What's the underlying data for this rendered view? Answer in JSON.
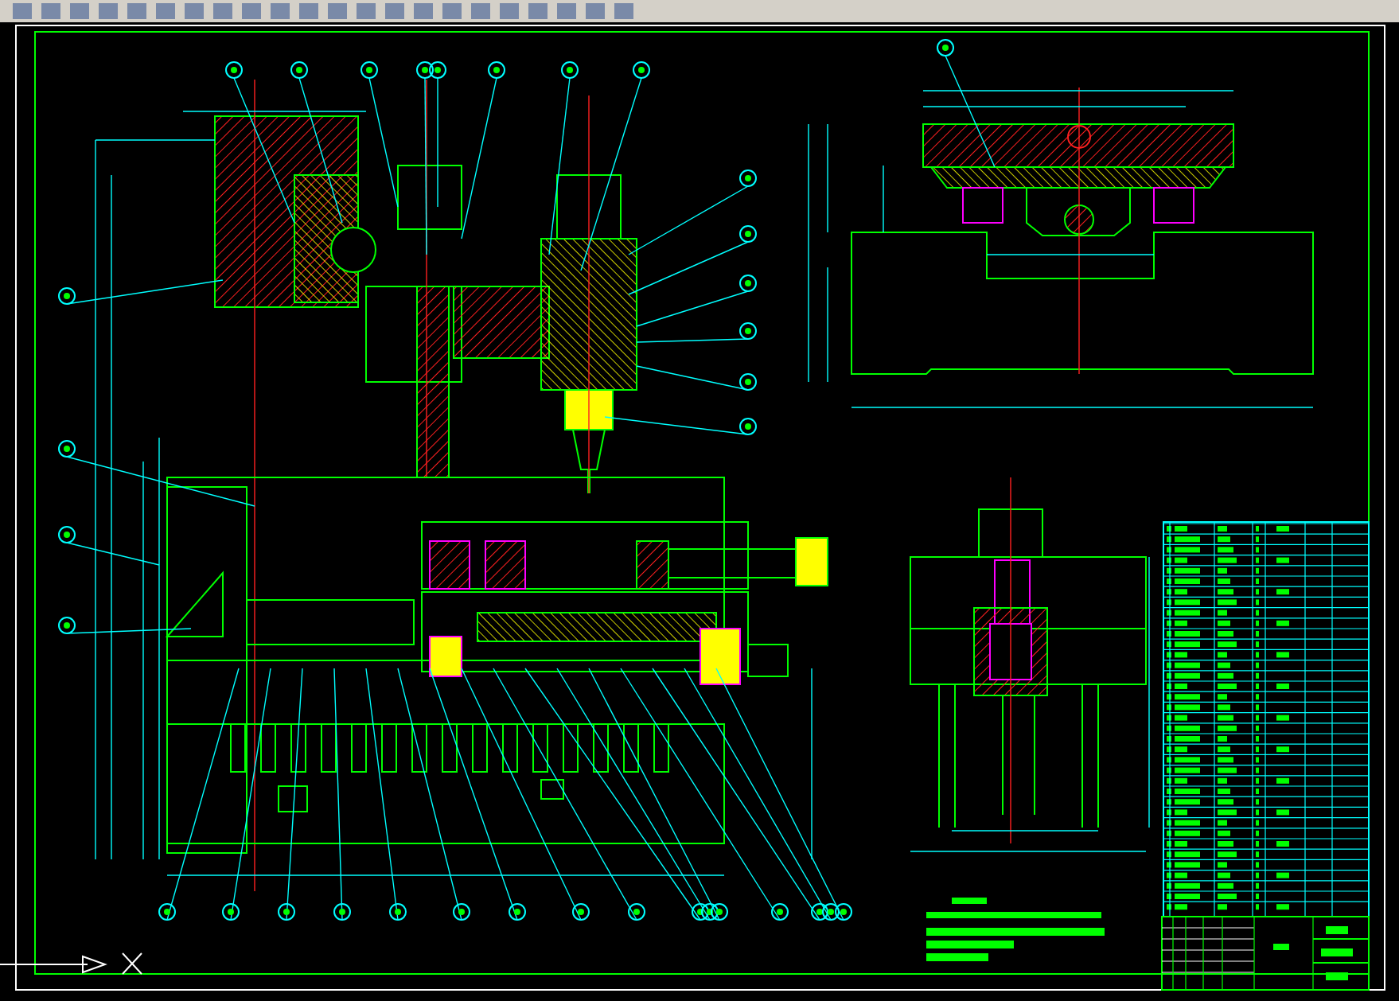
{
  "sheet": {
    "views": [
      {
        "kind": "front"
      },
      {
        "kind": "side"
      },
      {
        "kind": "section"
      }
    ],
    "parts_list": {
      "shown": true
    },
    "title_block": {
      "shown": true
    },
    "notes": {
      "shown": true
    }
  }
}
